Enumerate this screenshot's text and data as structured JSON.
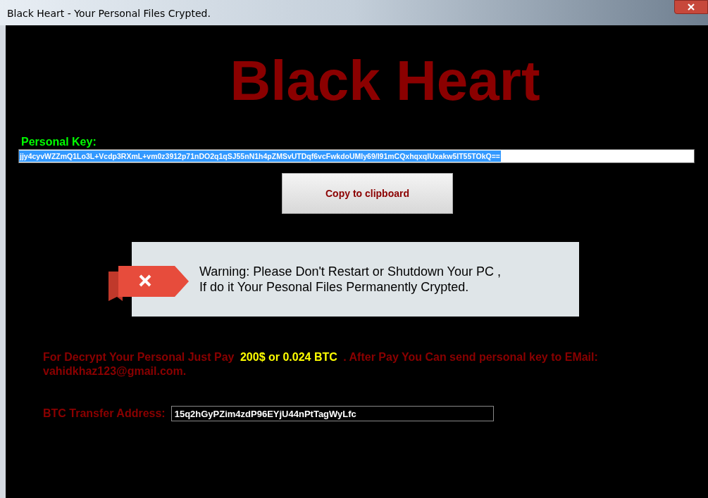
{
  "window": {
    "title": "Black Heart - Your Personal Files Crypted."
  },
  "heading": "Black Heart",
  "personal_key": {
    "label": "Personal Key:",
    "value": "jjy4cyvWZZmQ1Lo3L+Vcdp3RXmL+vm0z3912p71nDO2q1qSJ55nN1h4pZMSvUTDqf6vcFwkdoUMIy69/I91mCQxhqxqIUxakw5IT55TOkQ==",
    "selected": true
  },
  "copy_button": "Copy to clipboard",
  "warning": {
    "lines": [
      "Warning: Please Don't Restart or Shutdown Your PC ,",
      "If do it Your Pesonal Files Permanently Crypted."
    ]
  },
  "payment_text": "For Decrypt Your Personal Just Pay **200$ or 0.024 BTC** . After Pay You Can send personal key to EMail: vahidkhaz123@gmail.com.",
  "btc_address": {
    "label": "BTC Transfer Address:",
    "value": "15q2hGyPZim4zdP96EYjU44nPtTagWyLfc"
  }
}
